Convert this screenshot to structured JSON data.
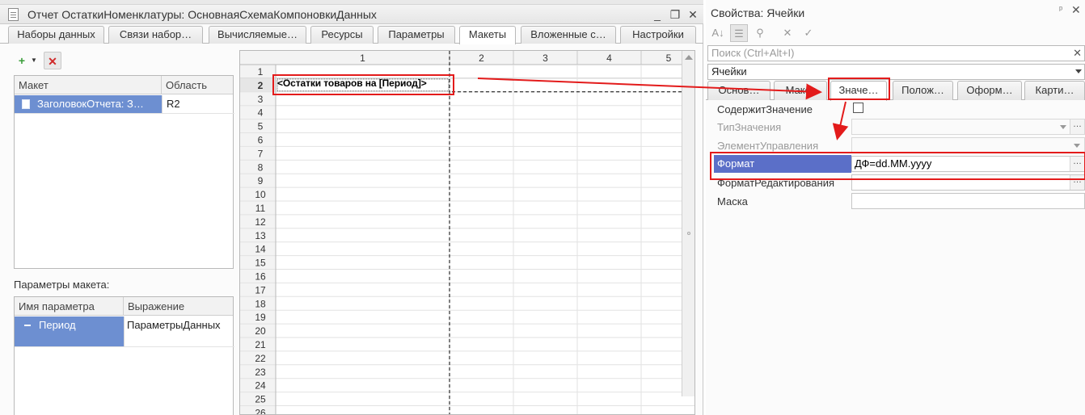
{
  "colors": {
    "selection": "#6d8fd1",
    "format_selection": "#5b6fc8",
    "annotation": "#e31b1b"
  },
  "left_window": {
    "title": "Отчет ОстаткиНоменклатуры: ОсновнаяСхемаКомпоновкиДанных",
    "controls": {
      "minimize": "_",
      "restore": "❐",
      "close": "✕"
    },
    "tabs": [
      "Наборы данных",
      "Связи набор…",
      "Вычисляемые…",
      "Ресурсы",
      "Параметры",
      "Макеты",
      "Вложенные с…",
      "Настройки"
    ],
    "active_tab": "Макеты",
    "toolbar": {
      "add_icon": "add-template-icon",
      "delete_icon": "delete-icon"
    },
    "templates_table": {
      "columns": [
        "Макет",
        "Область"
      ],
      "rows": [
        {
          "name": "ЗаголовокОтчета: З…",
          "area": "R2"
        }
      ]
    },
    "params_label": "Параметры макета:",
    "params_table": {
      "columns": [
        "Имя параметра",
        "Выражение"
      ],
      "rows": [
        {
          "name": "Период",
          "expression": "ПараметрыДанных"
        }
      ]
    },
    "sheet": {
      "column_headers": [
        "1",
        "2",
        "3",
        "4",
        "5"
      ],
      "row_headers": [
        "1",
        "2",
        "3",
        "4",
        "5",
        "6",
        "7",
        "8",
        "9",
        "10",
        "11",
        "12",
        "13",
        "14",
        "15",
        "16",
        "17",
        "18",
        "19",
        "20",
        "21",
        "22",
        "23",
        "24",
        "25",
        "26"
      ],
      "selected_row": "2",
      "cell_text": "<Остатки товаров на [Период]>"
    }
  },
  "properties": {
    "title": "Свойства: Ячейки",
    "pin": "ᵖ",
    "close": "✕",
    "toolbar_icons": [
      "sort-az-icon",
      "categories-icon",
      "filter-icon",
      "cancel-icon",
      "check-icon"
    ],
    "search_placeholder": "Поиск (Ctrl+Alt+I)",
    "object": "Ячейки",
    "tabs": [
      "Основ…",
      "Макет",
      "Значе…",
      "Полож…",
      "Оформ…",
      "Карти…"
    ],
    "active_tab": "Значе…",
    "rows": [
      {
        "label": "СодержитЗначение",
        "value": ""
      },
      {
        "label": "ТипЗначения",
        "value": ""
      },
      {
        "label": "ЭлементУправления",
        "value": ""
      },
      {
        "label": "Формат",
        "value": "ДФ=dd.MM.yyyy"
      },
      {
        "label": "ФорматРедактирования",
        "value": ""
      },
      {
        "label": "Маска",
        "value": ""
      }
    ]
  }
}
